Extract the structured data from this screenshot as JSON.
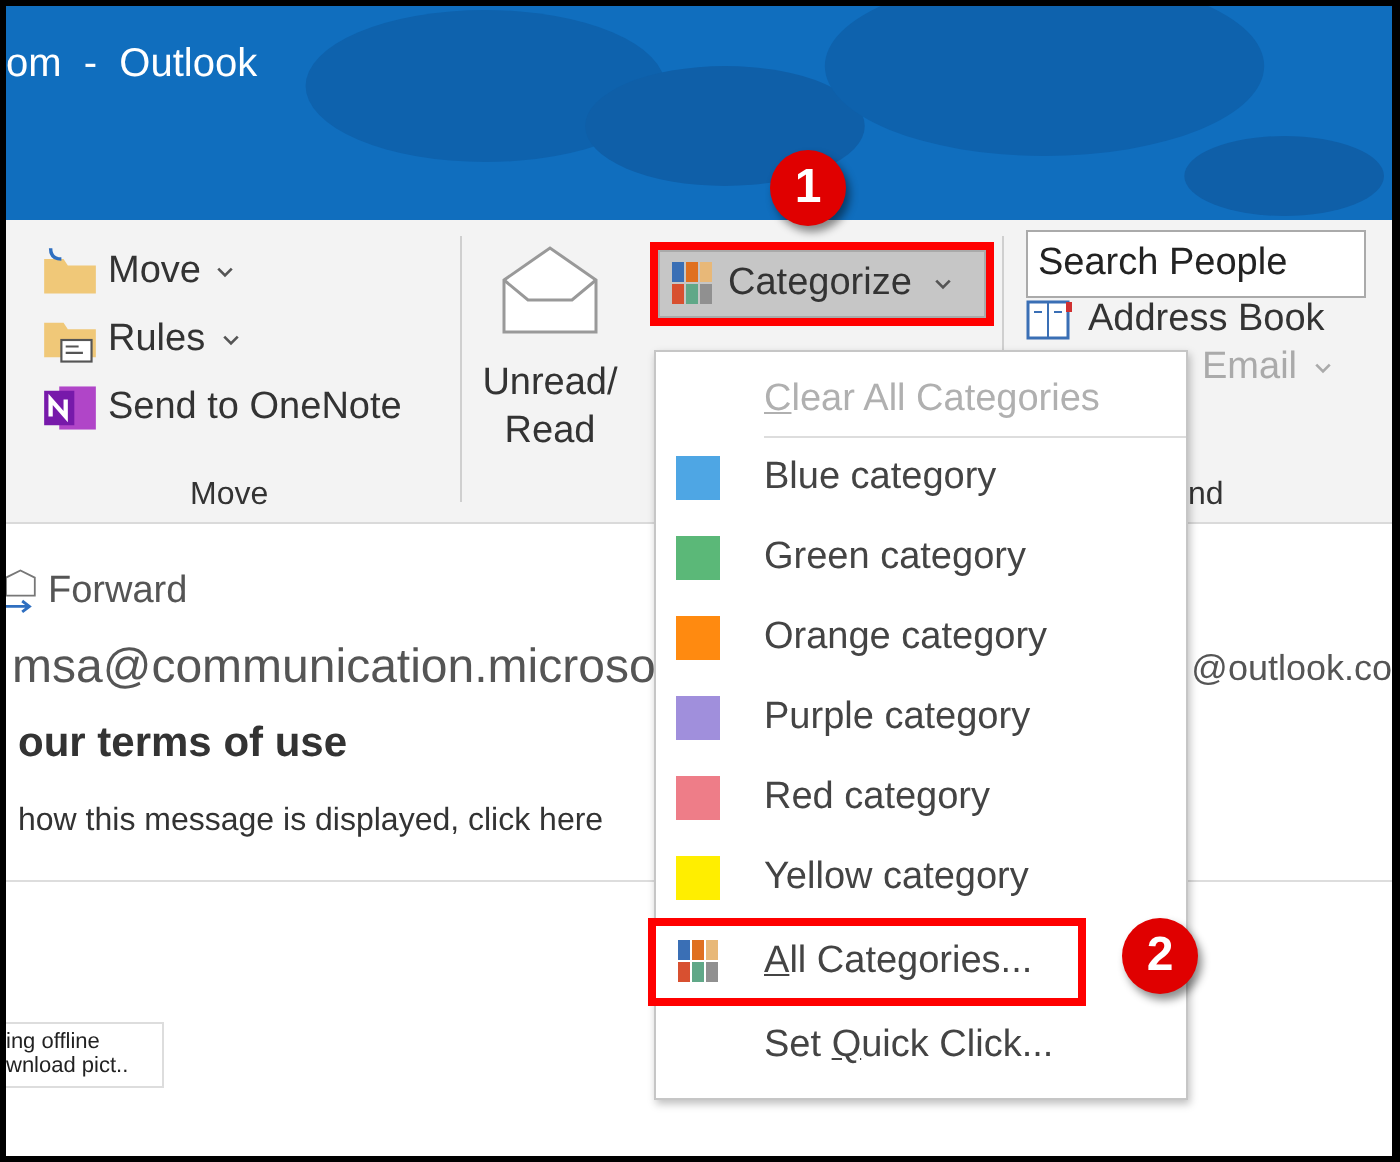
{
  "window": {
    "title": "om  -  Outlook"
  },
  "move_group": {
    "items": [
      {
        "kind": "move",
        "label": "Move",
        "has_menu": true
      },
      {
        "kind": "rules",
        "label": "Rules",
        "has_menu": true
      },
      {
        "kind": "onenote",
        "label": "Send to OneNote",
        "has_menu": false
      }
    ],
    "group_label": "Move"
  },
  "unread_read": {
    "label": "Unread/\nRead"
  },
  "categorize": {
    "label": "Categorize",
    "expanded": true,
    "highlighted": true,
    "step": "1"
  },
  "find_group": {
    "search": {
      "placeholder": "Search People"
    },
    "address_book": {
      "label": "Address Book"
    },
    "email": {
      "label": "Email",
      "disabled": true
    },
    "group_label": "nd"
  },
  "message": {
    "forward": "Forward",
    "sender": "msa@communication.microso",
    "recipient": "@outlook.co",
    "subject": "our terms of use",
    "notice": "how this message is displayed, click here",
    "thumbnail_lines": [
      "ing offline",
      "wnload pict.."
    ]
  },
  "menu": {
    "items": [
      {
        "kind": "action",
        "key": "C",
        "post": "lear All Categories",
        "disabled": true,
        "highlighted": false
      },
      {
        "kind": "separator"
      },
      {
        "kind": "color",
        "label": "Blue category",
        "color": "#4ea6e4"
      },
      {
        "kind": "color",
        "label": "Green category",
        "color": "#5bb878"
      },
      {
        "kind": "color",
        "label": "Orange category",
        "color": "#ff8a10"
      },
      {
        "kind": "color",
        "label": "Purple category",
        "color": "#a08fdc"
      },
      {
        "kind": "color",
        "label": "Red category",
        "color": "#ee7d88"
      },
      {
        "kind": "color",
        "label": "Yellow category",
        "color": "#ffee00"
      },
      {
        "kind": "grid_action",
        "key": "A",
        "post": "ll Categories...",
        "disabled": false,
        "highlighted": true,
        "step": "2"
      },
      {
        "kind": "action",
        "pre": "Set ",
        "key": "Q",
        "post": "uick Click...",
        "disabled": false,
        "highlighted": false
      }
    ]
  }
}
